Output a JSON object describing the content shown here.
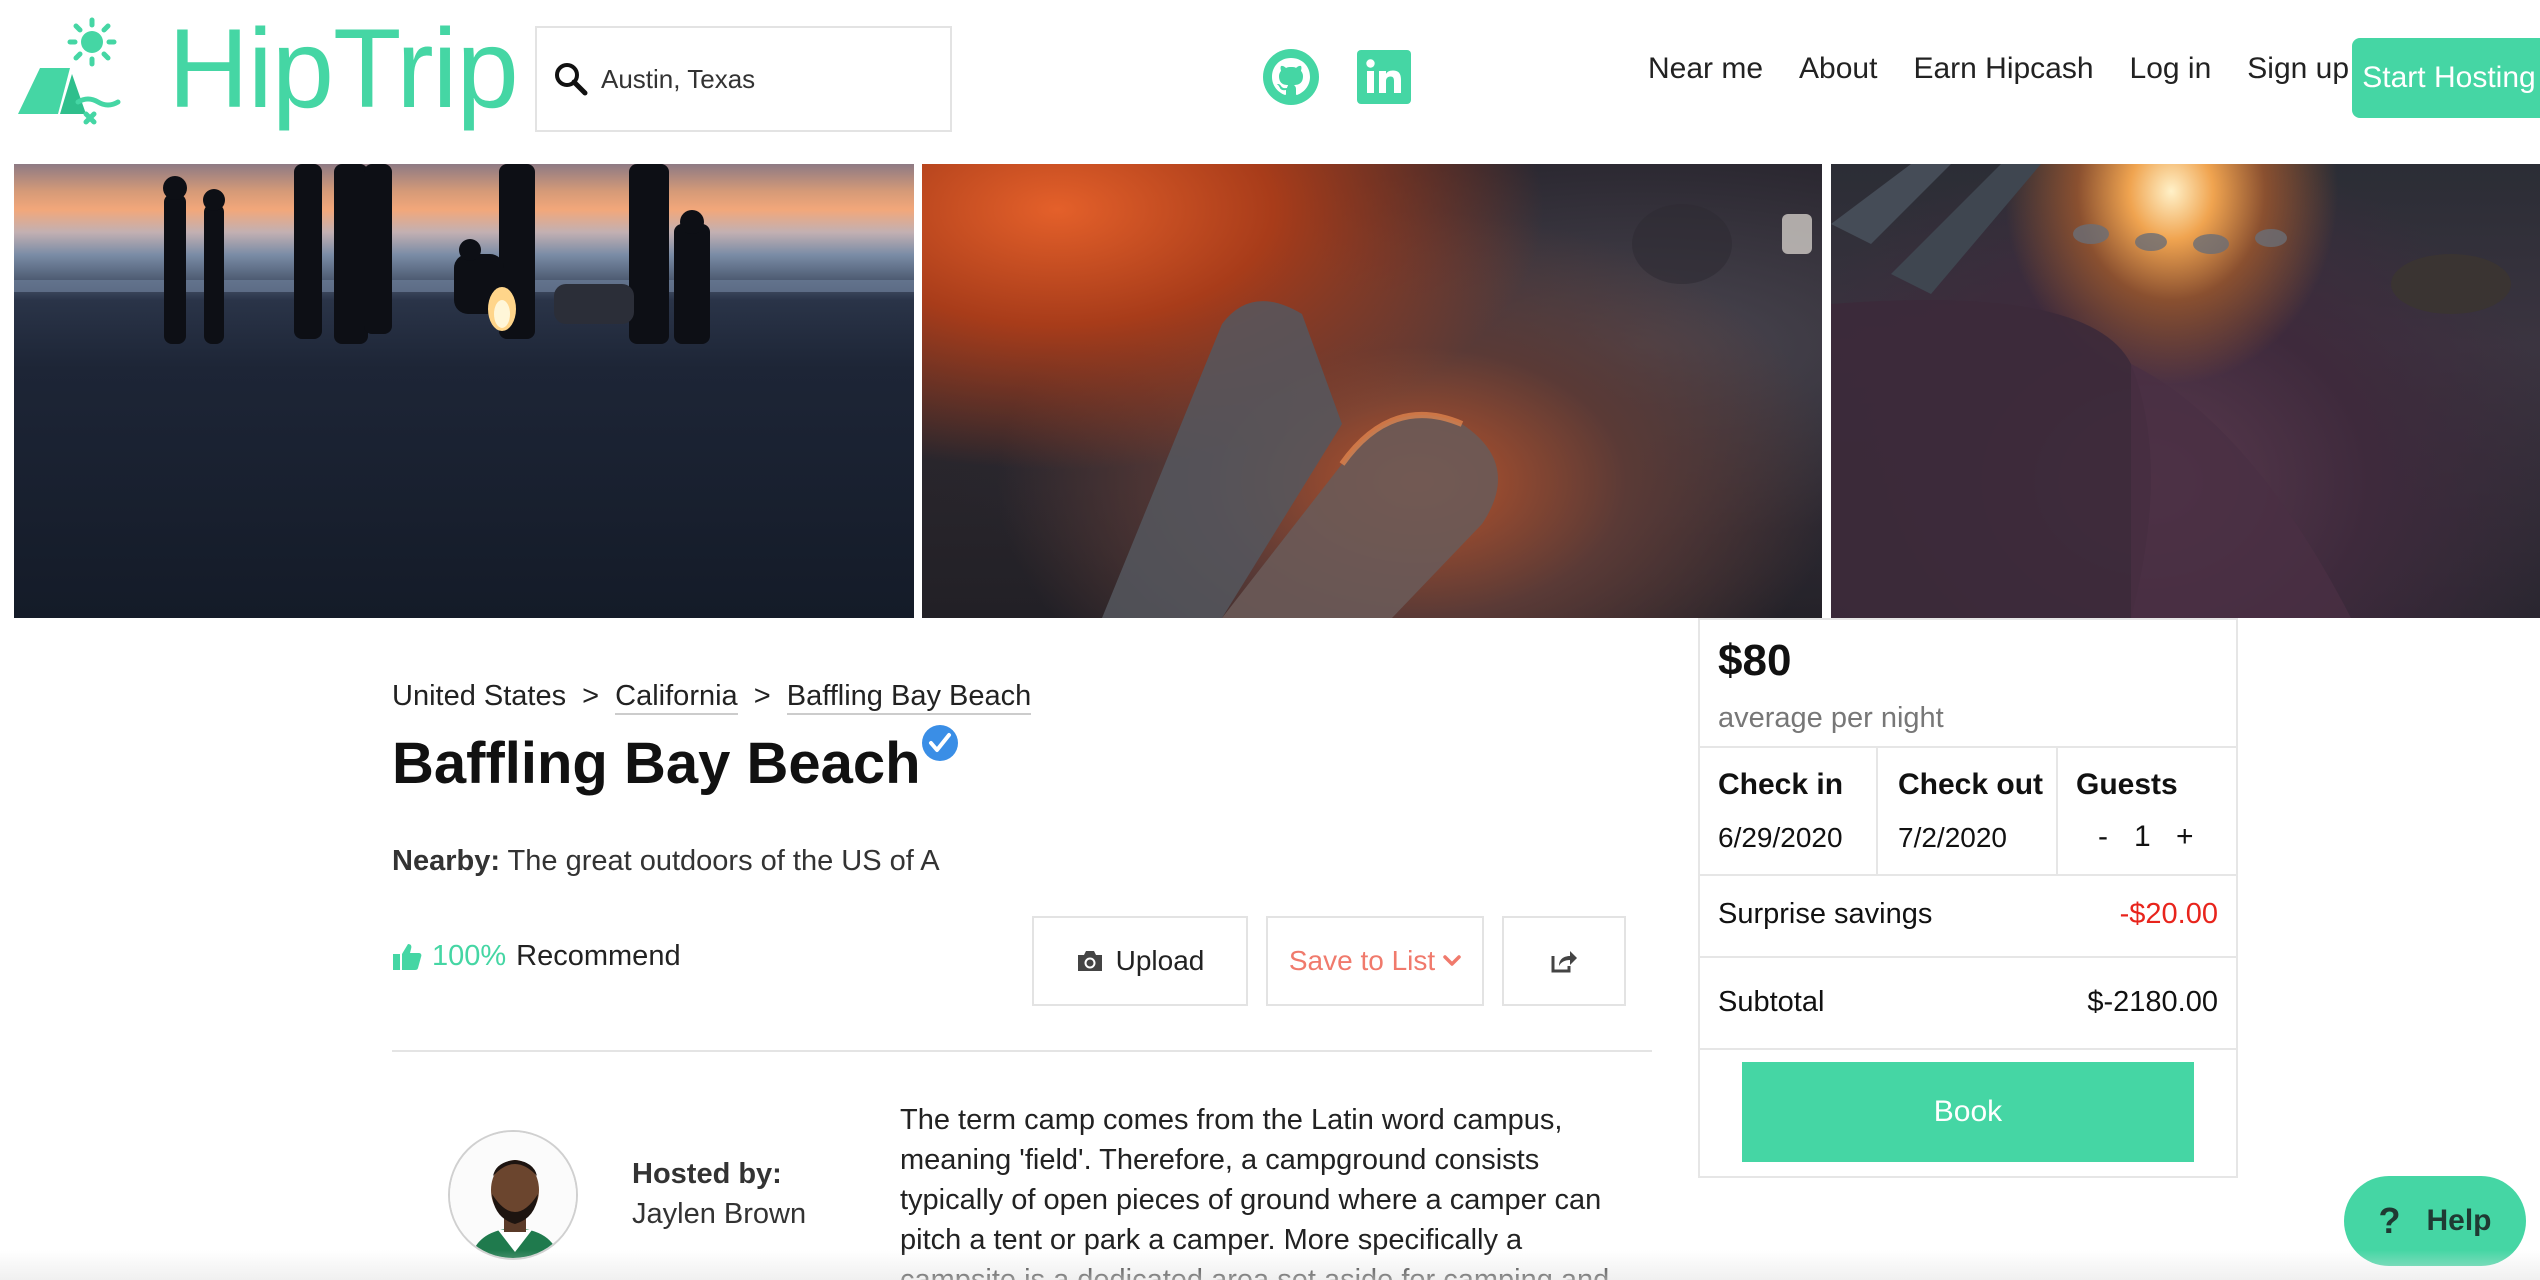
{
  "header": {
    "logo_text": "HipTrip",
    "search": {
      "value": "Austin, Texas",
      "placeholder": "Austin, Texas"
    },
    "social": {
      "github": "github-icon",
      "linkedin": "linkedin-icon"
    },
    "nav": {
      "near_me": "Near me",
      "about": "About",
      "earn_hipcash": "Earn Hipcash",
      "log_in": "Log in",
      "sign_up": "Sign up",
      "start_hosting": "Start Hosting"
    },
    "accent_color": "#45d6a4"
  },
  "listing": {
    "breadcrumb": [
      "United States",
      "California",
      "Baffling Bay Beach"
    ],
    "breadcrumb_separator": ">",
    "title": "Baffling Bay Beach",
    "nearby_label": "Nearby:",
    "nearby_text": "The great outdoors of the US of A",
    "recommend_pct": "100%",
    "recommend_label": "Recommend",
    "actions": {
      "upload": "Upload",
      "save_to_list": "Save to List"
    },
    "hosted_by_label": "Hosted by:",
    "host_name": "Jaylen Brown",
    "description": "The term camp comes from the Latin word campus, meaning 'field'. Therefore, a campground consists typically of open pieces of ground where a camper can pitch a tent or park a camper. More specifically a campsite is a dedicated area set aside for camping and"
  },
  "booking": {
    "price": "$80",
    "price_caption": "average per night",
    "check_in_label": "Check in",
    "check_in_value": "6/29/2020",
    "check_out_label": "Check out",
    "check_out_value": "7/2/2020",
    "guests_label": "Guests",
    "guests_minus": "-",
    "guests_value": "1",
    "guests_plus": "+",
    "savings_label": "Surprise savings",
    "savings_value": "-$20.00",
    "savings_color": "#e8241c",
    "subtotal_label": "Subtotal",
    "subtotal_value": "$-2180.00",
    "book_label": "Book"
  },
  "help": {
    "icon": "?",
    "label": "Help"
  }
}
